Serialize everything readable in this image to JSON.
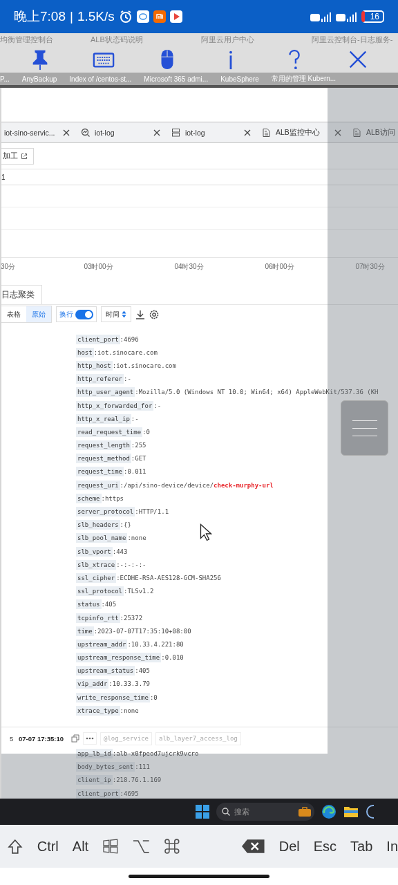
{
  "status_bar": {
    "time": "晚上7:08",
    "divider": "|",
    "speed": "1.5K/s",
    "battery": "16"
  },
  "remote_toolbar": {
    "browser_tabs": [
      {
        "title": "均衡管理控制台"
      },
      {
        "title": "ALB状态码说明"
      },
      {
        "title": "阿里云用户中心"
      },
      {
        "title": "阿里云控制台-日志服务-"
      }
    ],
    "tools": [
      {
        "kind": "pin"
      },
      {
        "kind": "keyboard"
      },
      {
        "kind": "mouse"
      },
      {
        "kind": "info"
      },
      {
        "kind": "help"
      },
      {
        "kind": "close"
      }
    ]
  },
  "bookmarks": [
    {
      "label": "P..."
    },
    {
      "label": "AnyBackup"
    },
    {
      "label": "Index of /centos-st..."
    },
    {
      "label": "Microsoft 365 admi..."
    },
    {
      "label": "KubeSphere"
    },
    {
      "label": "常用的管理 Kubern..."
    }
  ],
  "log_tabs": [
    {
      "kind": "search",
      "label": "iot-sino-servic..."
    },
    {
      "kind": "chart",
      "label": "iot-log"
    },
    {
      "kind": "store",
      "label": "iot-log"
    },
    {
      "kind": "doc",
      "label": "ALB监控中心"
    },
    {
      "kind": "doc",
      "label": "ALB访问"
    }
  ],
  "process_button": "加工",
  "query_row": "1",
  "time_axis": [
    "30分",
    "03时00分",
    "04时30分",
    "06时00分",
    "07时30分"
  ],
  "cluster_tab": "日志聚类",
  "view_toolbar": {
    "views": [
      {
        "label": "表格",
        "selected": false
      },
      {
        "label": "原始",
        "selected": true
      }
    ],
    "wrap": {
      "label": "换行",
      "on": true
    },
    "sort": "时间"
  },
  "log_fields": [
    {
      "key": "client_port",
      "value": ":4696"
    },
    {
      "key": "host",
      "value": ":iot.sinocare.com"
    },
    {
      "key": "http_host",
      "value": ":iot.sinocare.com"
    },
    {
      "key": "http_referer",
      "value": ":-"
    },
    {
      "key": "http_user_agent",
      "value": ":Mozilla/5.0 (Windows NT 10.0; Win64; x64) AppleWebKit/537.36 (KH"
    },
    {
      "key": "http_x_forwarded_for",
      "value": ":-"
    },
    {
      "key": "http_x_real_ip",
      "value": ":-"
    },
    {
      "key": "read_request_time",
      "value": ":0"
    },
    {
      "key": "request_length",
      "value": ":255"
    },
    {
      "key": "request_method",
      "value": ":GET"
    },
    {
      "key": "request_time",
      "value": ":0.011"
    },
    {
      "key": "request_uri",
      "value": ":/api/sino-device/device/",
      "highlight": "check-murphy-url"
    },
    {
      "key": "scheme",
      "value": ":https"
    },
    {
      "key": "server_protocol",
      "value": ":HTTP/1.1"
    },
    {
      "key": "slb_headers",
      "value": ":{}"
    },
    {
      "key": "slb_pool_name",
      "value": ":none"
    },
    {
      "key": "slb_vport",
      "value": ":443"
    },
    {
      "key": "slb_xtrace",
      "value": ":-:-:-:-"
    },
    {
      "key": "ssl_cipher",
      "value": ":ECDHE-RSA-AES128-GCM-SHA256"
    },
    {
      "key": "ssl_protocol",
      "value": ":TLSv1.2"
    },
    {
      "key": "status",
      "value": ":405"
    },
    {
      "key": "tcpinfo_rtt",
      "value": ":25372"
    },
    {
      "key": "time",
      "value": ":2023-07-07T17:35:10+08:00"
    },
    {
      "key": "upstream_addr",
      "value": ":10.33.4.221:80"
    },
    {
      "key": "upstream_response_time",
      "value": ":0.010"
    },
    {
      "key": "upstream_status",
      "value": ":405"
    },
    {
      "key": "vip_addr",
      "value": ":10.33.3.79"
    },
    {
      "key": "write_response_time",
      "value": ":0"
    },
    {
      "key": "xtrace_type",
      "value": ":none"
    }
  ],
  "entry": {
    "index": "5",
    "time": "07-07 17:35:10",
    "tags": [
      "@log_service",
      "alb_layer7_access_log"
    ],
    "fields": [
      {
        "key": "app_lb_id",
        "value": ":alb-x0fpeod7ujcrk9vcro"
      },
      {
        "key": "body_bytes_sent",
        "value": ":111"
      },
      {
        "key": "client_ip",
        "value": ":218.76.1.169"
      },
      {
        "key": "client_port",
        "value": ":4695"
      }
    ]
  },
  "taskbar": {
    "search_placeholder": "搜索"
  },
  "keys": [
    {
      "kind": "shift"
    },
    {
      "kind": "text",
      "label": "Ctrl"
    },
    {
      "kind": "text",
      "label": "Alt"
    },
    {
      "kind": "windows"
    },
    {
      "kind": "option"
    },
    {
      "kind": "command"
    },
    {
      "kind": "spacer"
    },
    {
      "kind": "backspace"
    },
    {
      "kind": "text",
      "label": "Del"
    },
    {
      "kind": "text",
      "label": "Esc"
    },
    {
      "kind": "text",
      "label": "Tab"
    },
    {
      "kind": "text",
      "label": "In"
    }
  ]
}
